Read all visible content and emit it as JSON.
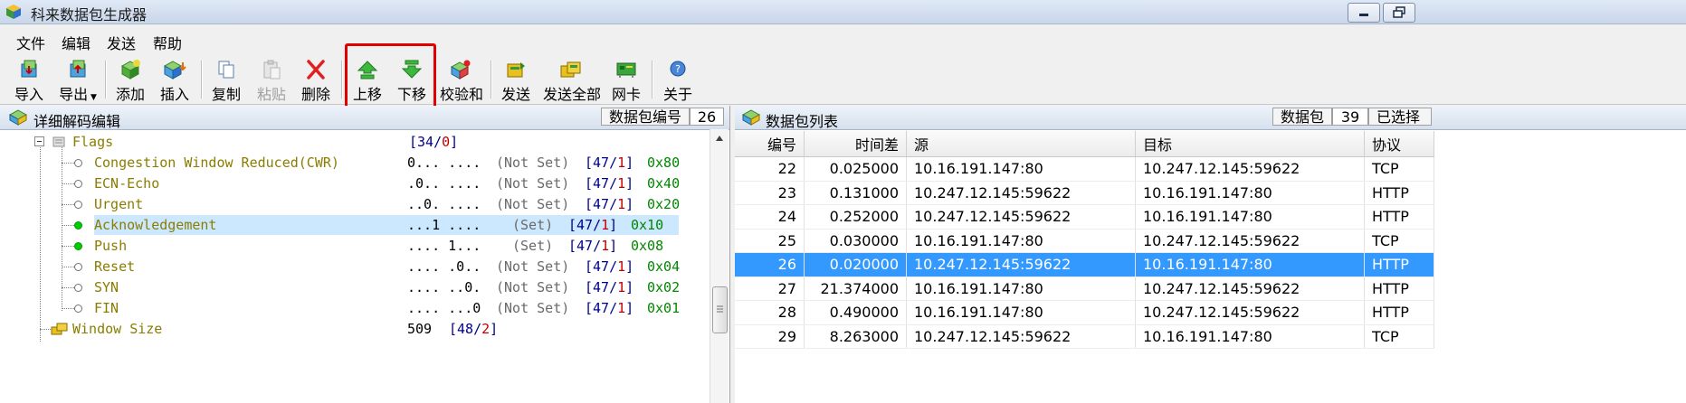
{
  "window": {
    "title": "科来数据包生成器"
  },
  "menu": [
    "文件",
    "编辑",
    "发送",
    "帮助"
  ],
  "toolbar": {
    "import": "导入",
    "export": "导出",
    "add": "添加",
    "insert": "插入",
    "copy": "复制",
    "paste": "粘贴",
    "delete": "删除",
    "move_up": "上移",
    "move_down": "下移",
    "checksum": "校验和",
    "send": "发送",
    "send_all": "发送全部",
    "nic": "网卡",
    "about": "关于"
  },
  "left_pane": {
    "title": "详细解码编辑",
    "packet_no_label": "数据包编号",
    "packet_no_value": "26",
    "tree": [
      {
        "name": "Flags",
        "bits": "",
        "set": "",
        "off": "34",
        "len": "0",
        "hex": ""
      },
      {
        "name": "Congestion Window Reduced(CWR)",
        "bits": "0... ....",
        "set": "(Not Set)",
        "off": "47",
        "len": "1",
        "hex": "0x80"
      },
      {
        "name": "ECN-Echo",
        "bits": ".0.. ....",
        "set": "(Not Set)",
        "off": "47",
        "len": "1",
        "hex": "0x40"
      },
      {
        "name": "Urgent",
        "bits": "..0. ....",
        "set": "(Not Set)",
        "off": "47",
        "len": "1",
        "hex": "0x20"
      },
      {
        "name": "Acknowledgement",
        "bits": "...1 ....",
        "set": "(Set)",
        "off": "47",
        "len": "1",
        "hex": "0x10"
      },
      {
        "name": "Push",
        "bits": ".... 1...",
        "set": "(Set)",
        "off": "47",
        "len": "1",
        "hex": "0x08"
      },
      {
        "name": "Reset",
        "bits": ".... .0..",
        "set": "(Not Set)",
        "off": "47",
        "len": "1",
        "hex": "0x04"
      },
      {
        "name": "SYN",
        "bits": ".... ..0.",
        "set": "(Not Set)",
        "off": "47",
        "len": "1",
        "hex": "0x02"
      },
      {
        "name": "FIN",
        "bits": ".... ...0",
        "set": "(Not Set)",
        "off": "47",
        "len": "1",
        "hex": "0x01"
      },
      {
        "name": "Window Size",
        "bits": "509",
        "set": "",
        "off": "48",
        "len": "2",
        "hex": ""
      }
    ]
  },
  "right_pane": {
    "title": "数据包列表",
    "packet_label": "数据包",
    "packet_count": "39",
    "selected_label": "已选择",
    "columns": [
      "编号",
      "时间差",
      "源",
      "目标",
      "协议"
    ],
    "rows": [
      [
        "22",
        "0.025000",
        "10.16.191.147:80",
        "10.247.12.145:59622",
        "TCP"
      ],
      [
        "23",
        "0.131000",
        "10.247.12.145:59622",
        "10.16.191.147:80",
        "HTTP"
      ],
      [
        "24",
        "0.252000",
        "10.247.12.145:59622",
        "10.16.191.147:80",
        "HTTP"
      ],
      [
        "25",
        "0.030000",
        "10.16.191.147:80",
        "10.247.12.145:59622",
        "TCP"
      ],
      [
        "26",
        "0.020000",
        "10.247.12.145:59622",
        "10.16.191.147:80",
        "HTTP"
      ],
      [
        "27",
        "21.374000",
        "10.16.191.147:80",
        "10.247.12.145:59622",
        "HTTP"
      ],
      [
        "28",
        "0.490000",
        "10.16.191.147:80",
        "10.247.12.145:59622",
        "HTTP"
      ],
      [
        "29",
        "8.263000",
        "10.247.12.145:59622",
        "10.16.191.147:80",
        "TCP"
      ]
    ],
    "selected_row": "26"
  }
}
